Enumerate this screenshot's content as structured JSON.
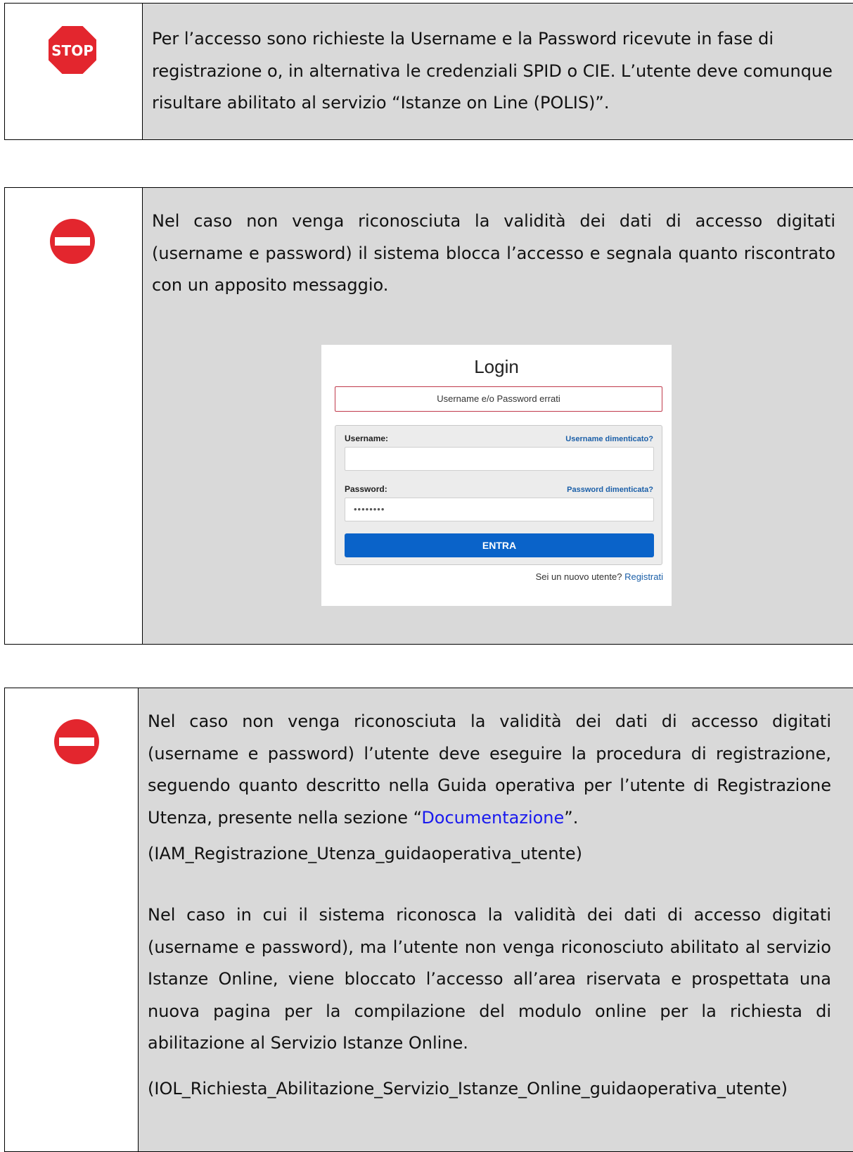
{
  "box1": {
    "text": "Per l’accesso sono richieste la Username e la Password  ricevute in fase di registrazione o, in alternativa le credenziali SPID o CIE. L’utente deve comunque risultare abilitato al servizio “Istanze on Line (POLIS)”.",
    "icon": "stop-sign-icon",
    "icon_text": "STOP"
  },
  "box2": {
    "text": "Nel caso non venga riconosciuta la validità dei dati di accesso digitati (username e password) il sistema blocca l’accesso e segnala quanto riscontrato con un apposito messaggio.",
    "icon": "no-entry-icon",
    "login": {
      "title": "Login",
      "error": "Username e/o Password errati",
      "username_label": "Username:",
      "username_forgot": "Username dimenticato?",
      "username_value": "",
      "password_label": "Password:",
      "password_forgot": "Password dimenticata?",
      "password_value": "••••••••",
      "submit": "ENTRA",
      "new_user": "Sei un nuovo utente?",
      "register": "Registrati"
    }
  },
  "box3": {
    "icon": "no-entry-icon",
    "p1_before": "Nel caso non venga riconosciuta la validità dei dati di accesso digitati (username e password) l’utente deve eseguire la procedura di registrazione, seguendo quanto descritto nella Guida operativa per l’utente di Registrazione Utenza, presente nella sezione  “",
    "p1_link": "Documentazione",
    "p1_after": "”.",
    "p2": "(IAM_Registrazione_Utenza_guidaoperativa_utente)",
    "p3": "Nel caso in cui il sistema riconosca la validità dei dati di accesso digitati (username e password), ma l’utente non venga riconosciuto abilitato al servizio Istanze Online, viene bloccato l’accesso all’area riservata e prospettata una nuova pagina per la compilazione del modulo online per la richiesta di abilitazione al Servizio Istanze Online.",
    "p4": "(IOL_Richiesta_Abilitazione_Servizio_Istanze_Online_guidaoperativa_utente)"
  },
  "colors": {
    "box_background": "#d9d9d9",
    "link": "#1a1aee",
    "stop_red": "#e3262e",
    "login_button": "#0a63c9",
    "login_error_border": "#c0394b"
  }
}
